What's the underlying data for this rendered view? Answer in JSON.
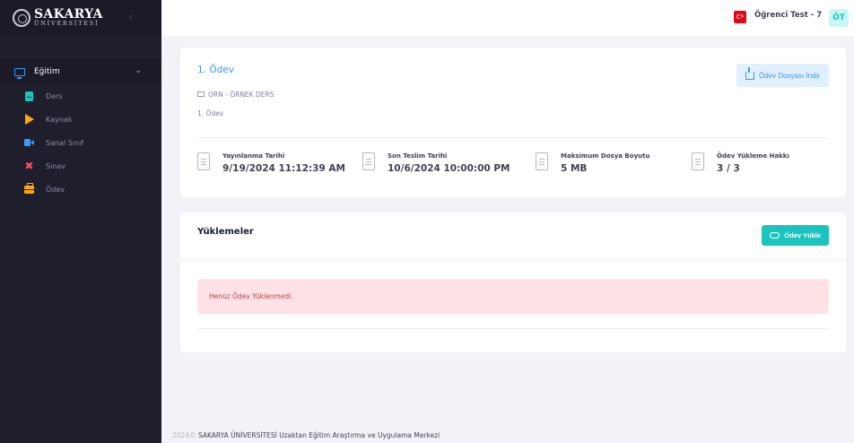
{
  "brand": {
    "name": "SAKARYA",
    "subtitle": "ÜNİVERSİTESİ"
  },
  "sidebar": {
    "toggle_icon": "chevron-left-icon",
    "section": {
      "label": "Eğitim",
      "icon": "monitor-icon"
    },
    "items": [
      {
        "label": "Ders",
        "icon": "book-icon",
        "color": "#1bc5bd"
      },
      {
        "label": "Kaynak",
        "icon": "play-icon",
        "color": "#ffa800"
      },
      {
        "label": "Sanal Sınıf",
        "icon": "video-icon",
        "color": "#3699ff"
      },
      {
        "label": "Sınav",
        "icon": "tools-icon",
        "color": "#f64e60"
      },
      {
        "label": "Ödev",
        "icon": "briefcase-icon",
        "color": "#ffa800"
      }
    ]
  },
  "header": {
    "flag_icon": "turkey-flag-icon",
    "flag_text": "C*",
    "user_name": "Öğrenci Test - 7",
    "avatar_initials": "ÖT"
  },
  "assignment": {
    "title": "1. Ödev",
    "course": "ORN - ÖRNEK DERS",
    "description": "1. Ödev",
    "download_button": "Ödev Dosyası İndir",
    "stats": [
      {
        "label": "Yayınlanma Tarihi",
        "value": "9/19/2024 11:12:39 AM"
      },
      {
        "label": "Son Teslim Tarihi",
        "value": "10/6/2024 10:00:00 PM"
      },
      {
        "label": "Maksimum Dosya Boyutu",
        "value": "5 MB"
      },
      {
        "label": "Ödev Yükleme Hakkı",
        "value": "3 / 3"
      }
    ]
  },
  "uploads": {
    "title": "Yüklemeler",
    "upload_button": "Ödev Yükle",
    "empty_message": "Henüz Ödev Yüklenmedi."
  },
  "footer": {
    "year": "2024©",
    "text": "SAKARYA ÜNİVERSİTESİ Uzaktan Eğitim Araştırma ve Uygulama Merkezi"
  },
  "colors": {
    "accent": "#3699ff",
    "success": "#1bc5bd",
    "danger_light": "#ffe2e5",
    "sidebar_bg": "#1e1e2d"
  }
}
